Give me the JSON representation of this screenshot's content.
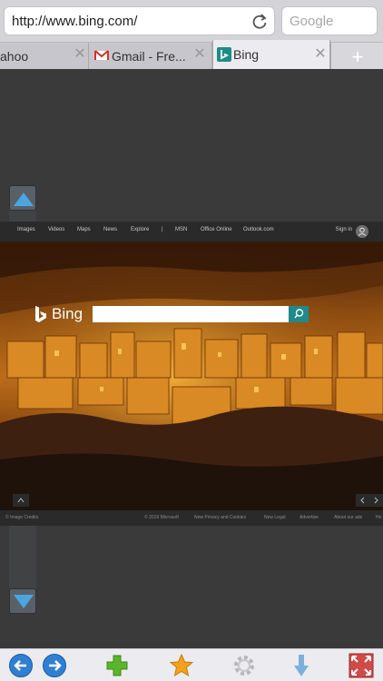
{
  "address_bar": {
    "url": "http://www.bing.com/"
  },
  "search_bar": {
    "placeholder": "Google"
  },
  "tabs": [
    {
      "label": "ahoo",
      "icon": "yahoo-favicon"
    },
    {
      "label": "Gmail - Fre...",
      "icon": "gmail-icon"
    },
    {
      "label": "Bing",
      "icon": "bing-icon"
    }
  ],
  "new_tab_label": "+",
  "bing": {
    "nav": [
      "Images",
      "Videos",
      "Maps",
      "News",
      "Explore",
      "|",
      "MSN",
      "Office Online",
      "Outlook.com"
    ],
    "sign_in": "Sign in",
    "logo": "Bing",
    "footer_left": "© Image Credits",
    "footer_links": [
      "© 2019 Microsoft",
      "New Privacy and Cookies",
      "New Legal",
      "Advertise",
      "About our ads",
      "He"
    ]
  },
  "colors": {
    "accent": "#1e8b8b",
    "nav_arrow": "#2f7fd2",
    "add_green": "#5ab52a",
    "star": "#f2a21a"
  },
  "toolbar": [
    "back-icon",
    "forward-icon",
    "add-bookmark-icon",
    "favorites-star-icon",
    "settings-gear-icon",
    "download-icon",
    "fullscreen-icon"
  ]
}
